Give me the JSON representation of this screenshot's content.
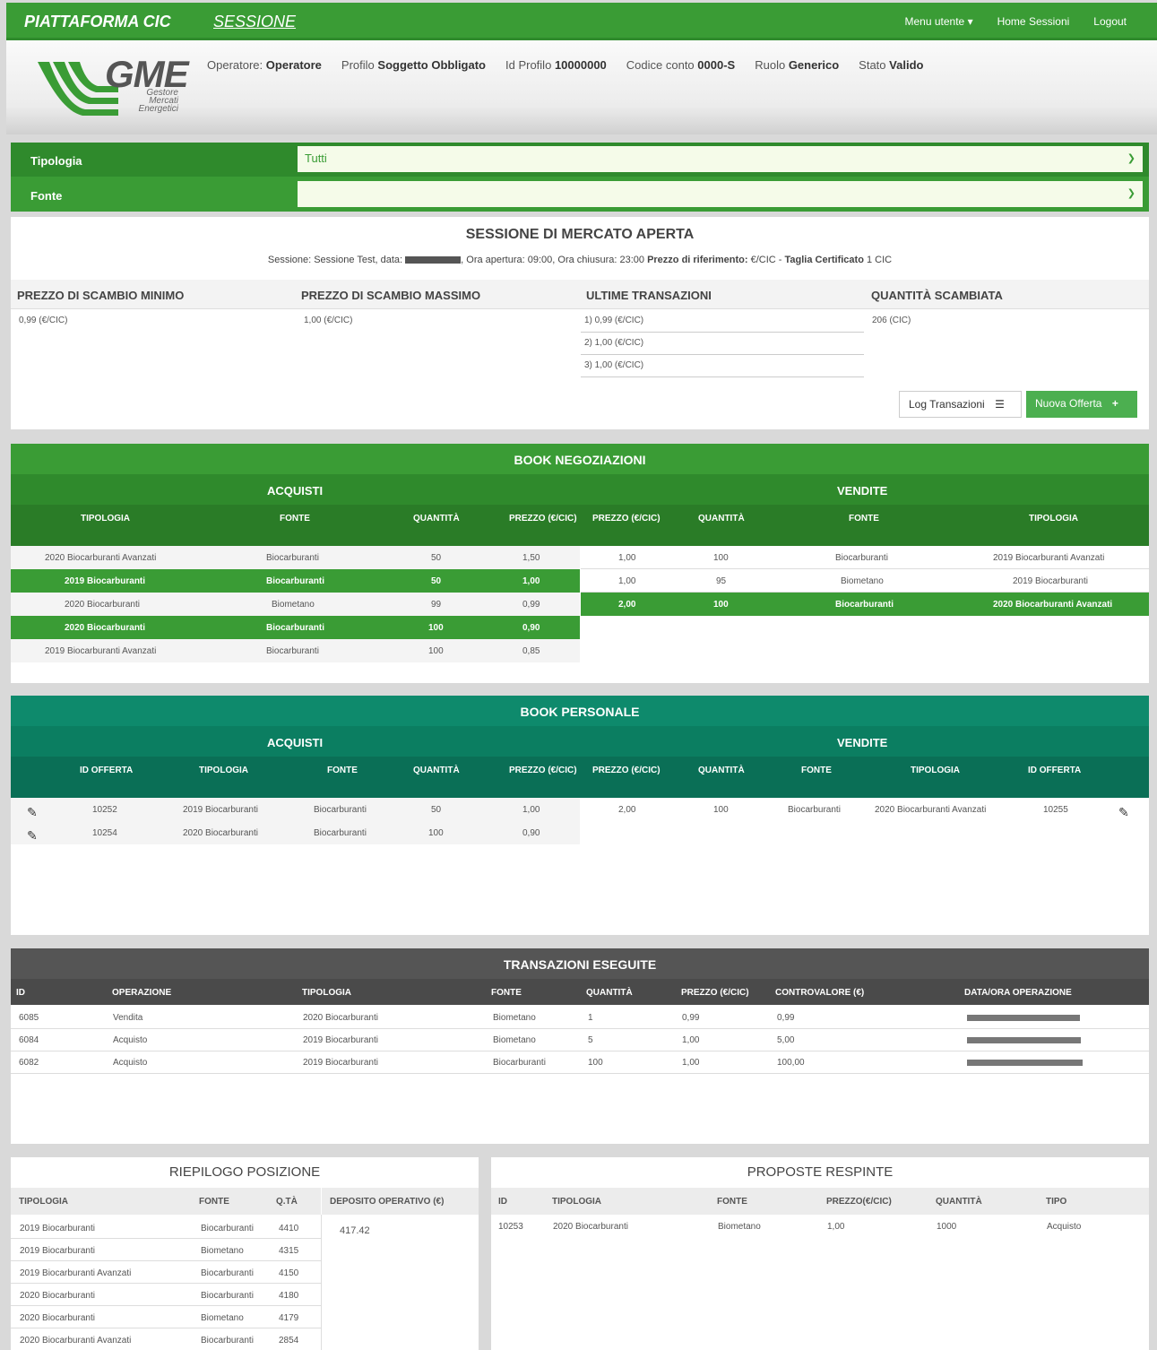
{
  "navbar": {
    "brand": "PIATTAFORMA CIC",
    "session_link": "SESSIONE",
    "menu_utente": "Menu utente ▾",
    "home_sessioni": "Home Sessioni",
    "logout": "Logout"
  },
  "logo": {
    "name": "GME",
    "line1": "Gestore",
    "line2": "Mercati",
    "line3": "Energetici"
  },
  "user_info": {
    "operatore_label": "Operatore:",
    "operatore_value": "Operatore",
    "profilo_label": "Profilo",
    "profilo_value": "Soggetto Obbligato",
    "id_profilo_label": "Id Profilo",
    "id_profilo_value": "10000000",
    "codice_label": "Codice conto",
    "codice_value": "0000-S",
    "ruolo_label": "Ruolo",
    "ruolo_value": "Generico",
    "stato_label": "Stato",
    "stato_value": "Valido"
  },
  "filters": {
    "tipologia_label": "Tipologia",
    "tipologia_value": "Tutti",
    "fonte_label": "Fonte",
    "fonte_value": ""
  },
  "session": {
    "title": "SESSIONE DI MERCATO APERTA",
    "info_pre": "Sessione: Sessione Test, data:",
    "info_post": ", Ora apertura: 09:00, Ora chiusura: 23:00",
    "ref_label": "Prezzo di riferimento:",
    "ref_value": "€/CIC -",
    "taglia_label": "Taglia Certificato",
    "taglia_value": "1 CIC",
    "min_label": "PREZZO DI SCAMBIO MINIMO",
    "min_value": "0,99 (€/CIC)",
    "max_label": "PREZZO DI SCAMBIO MASSIMO",
    "max_value": "1,00 (€/CIC)",
    "last_label": "ULTIME TRANSAZIONI",
    "last": [
      "1) 0,99 (€/CIC)",
      "2) 1,00 (€/CIC)",
      "3) 1,00 (€/CIC)"
    ],
    "qty_label": "QUANTITÀ SCAMBIATA",
    "qty_value": "206 (CIC)",
    "log_button": "Log Transazioni",
    "new_button": "Nuova Offerta"
  },
  "book_neg": {
    "title": "BOOK NEGOZIAZIONI",
    "acquisti": "ACQUISTI",
    "vendite": "VENDITE",
    "h_tipologia": "TIPOLOGIA",
    "h_fonte": "FONTE",
    "h_quantita": "QUANTITÀ",
    "h_prezzo": "PREZZO (€/CIC)",
    "buy": [
      {
        "tip": "2020 Biocarburanti Avanzati",
        "fonte": "Biocarburanti",
        "q": "50",
        "p": "1,50"
      },
      {
        "tip": "2019 Biocarburanti",
        "fonte": "Biocarburanti",
        "q": "50",
        "p": "1,00"
      },
      {
        "tip": "2020 Biocarburanti",
        "fonte": "Biometano",
        "q": "99",
        "p": "0,99"
      },
      {
        "tip": "2020 Biocarburanti",
        "fonte": "Biocarburanti",
        "q": "100",
        "p": "0,90"
      },
      {
        "tip": "2019 Biocarburanti Avanzati",
        "fonte": "Biocarburanti",
        "q": "100",
        "p": "0,85"
      }
    ],
    "sell": [
      {
        "p": "1,00",
        "q": "100",
        "fonte": "Biocarburanti",
        "tip": "2019 Biocarburanti Avanzati"
      },
      {
        "p": "1,00",
        "q": "95",
        "fonte": "Biometano",
        "tip": "2019 Biocarburanti"
      },
      {
        "p": "2,00",
        "q": "100",
        "fonte": "Biocarburanti",
        "tip": "2020 Biocarburanti Avanzati"
      }
    ]
  },
  "book_pers": {
    "title": "BOOK PERSONALE",
    "acquisti": "ACQUISTI",
    "vendite": "VENDITE",
    "h_id": "ID OFFERTA",
    "h_tipologia": "TIPOLOGIA",
    "h_fonte": "FONTE",
    "h_quantita": "QUANTITÀ",
    "h_prezzo": "PREZZO (€/CIC)",
    "buy": [
      {
        "id": "10252",
        "tip": "2019 Biocarburanti",
        "fonte": "Biocarburanti",
        "q": "50",
        "p": "1,00"
      },
      {
        "id": "10254",
        "tip": "2020 Biocarburanti",
        "fonte": "Biocarburanti",
        "q": "100",
        "p": "0,90"
      }
    ],
    "sell": [
      {
        "p": "2,00",
        "q": "100",
        "fonte": "Biocarburanti",
        "tip": "2020 Biocarburanti Avanzati",
        "id": "10255"
      }
    ]
  },
  "tx": {
    "title": "TRANSAZIONI ESEGUITE",
    "h_id": "ID",
    "h_op": "OPERAZIONE",
    "h_tip": "TIPOLOGIA",
    "h_fonte": "FONTE",
    "h_q": "QUANTITÀ",
    "h_p": "PREZZO (€/CIC)",
    "h_cv": "CONTROVALORE (€)",
    "h_dt": "DATA/ORA OPERAZIONE",
    "rows": [
      {
        "id": "6085",
        "op": "Vendita",
        "tip": "2020 Biocarburanti",
        "fonte": "Biometano",
        "q": "1",
        "p": "0,99",
        "cv": "0,99"
      },
      {
        "id": "6084",
        "op": "Acquisto",
        "tip": "2019 Biocarburanti",
        "fonte": "Biometano",
        "q": "5",
        "p": "1,00",
        "cv": "5,00"
      },
      {
        "id": "6082",
        "op": "Acquisto",
        "tip": "2019 Biocarburanti",
        "fonte": "Biocarburanti",
        "q": "100",
        "p": "1,00",
        "cv": "100,00"
      }
    ]
  },
  "riepilogo": {
    "title": "RIEPILOGO POSIZIONE",
    "h_tip": "TIPOLOGIA",
    "h_fonte": "FONTE",
    "h_qta": "Q.TÀ",
    "h_dep": "DEPOSITO OPERATIVO (€)",
    "deposito": "417.42",
    "rows": [
      {
        "tip": "2019 Biocarburanti",
        "fonte": "Biocarburanti",
        "q": "4410"
      },
      {
        "tip": "2019 Biocarburanti",
        "fonte": "Biometano",
        "q": "4315"
      },
      {
        "tip": "2019 Biocarburanti Avanzati",
        "fonte": "Biocarburanti",
        "q": "4150"
      },
      {
        "tip": "2020 Biocarburanti",
        "fonte": "Biocarburanti",
        "q": "4180"
      },
      {
        "tip": "2020 Biocarburanti",
        "fonte": "Biometano",
        "q": "4179"
      },
      {
        "tip": "2020 Biocarburanti Avanzati",
        "fonte": "Biocarburanti",
        "q": "2854"
      }
    ]
  },
  "respinte": {
    "title": "PROPOSTE RESPINTE",
    "h_id": "ID",
    "h_tip": "TIPOLOGIA",
    "h_fonte": "FONTE",
    "h_p": "PREZZO(€/CIC)",
    "h_q": "QUANTITÀ",
    "h_tipo": "TIPO",
    "rows": [
      {
        "id": "10253",
        "tip": "2020 Biocarburanti",
        "fonte": "Biometano",
        "p": "1,00",
        "q": "1000",
        "tipo": "Acquisto"
      }
    ]
  },
  "colors": {
    "green": "#3a9c35",
    "teal": "#0e8a6c",
    "dark": "#4a4a4a"
  }
}
